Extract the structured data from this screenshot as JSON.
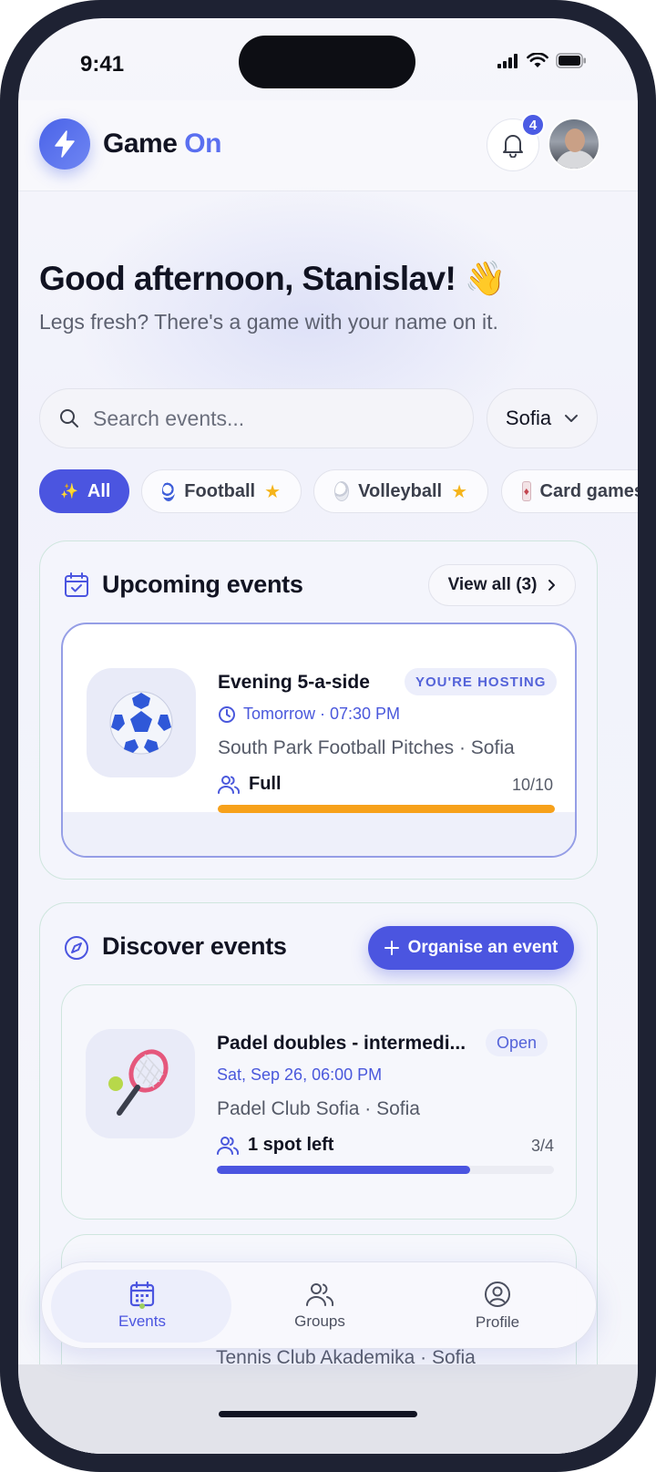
{
  "status_bar": {
    "time": "9:41"
  },
  "header": {
    "app_name_part1": "Game",
    "app_name_part2": "On",
    "notification_count": "4"
  },
  "greeting": {
    "title": "Good afternoon, Stanislav! 👋",
    "subtitle": "Legs fresh? There's a game with your name on it."
  },
  "search": {
    "placeholder": "Search events...",
    "value": ""
  },
  "city": {
    "selected": "Sofia"
  },
  "filters": [
    {
      "label": "All",
      "active": true,
      "starred": false
    },
    {
      "label": "Football",
      "active": false,
      "starred": true
    },
    {
      "label": "Volleyball",
      "active": false,
      "starred": true
    },
    {
      "label": "Card games",
      "active": false,
      "starred": false
    }
  ],
  "upcoming": {
    "title": "Upcoming events",
    "view_all_label": "View all (3)",
    "event": {
      "title": "Evening 5-a-side",
      "tag": "YOU'RE HOSTING",
      "time": "Tomorrow · 07:30 PM",
      "place": "South Park Football Pitches · Sofia",
      "capacity_label": "Full",
      "count": "10/10",
      "progress": 1.0,
      "bar_color": "#f7a11a"
    }
  },
  "discover": {
    "title": "Discover events",
    "organise_label": "Organise an event",
    "event": {
      "title": "Padel doubles - intermedi...",
      "tag": "Open",
      "time": "Sat, Sep 26, 06:00 PM",
      "place": "Padel Club Sofia · Sofia",
      "capacity_label": "1 spot left",
      "count": "3/4",
      "progress": 0.75,
      "bar_color": "#4b55e0"
    },
    "next_event_place": "Tennis Club Akademika · Sofia"
  },
  "bottom_nav": {
    "events": "Events",
    "groups": "Groups",
    "profile": "Profile"
  },
  "colors": {
    "accent": "#4b55e0",
    "accent_light": "#5a6ff0",
    "warning": "#f7a11a"
  }
}
